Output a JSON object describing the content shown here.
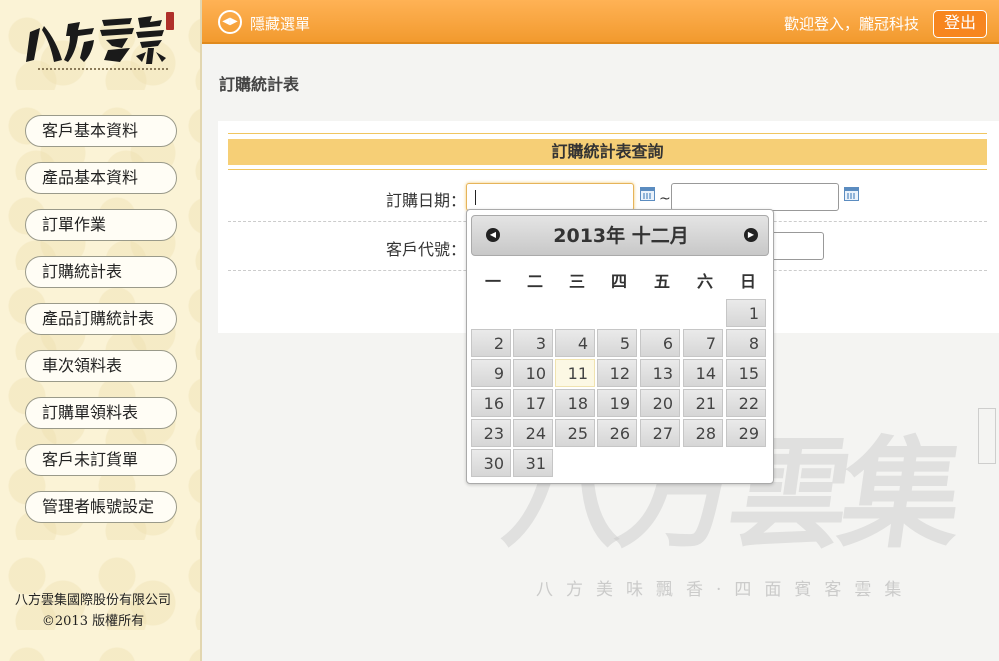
{
  "sidebar": {
    "logo_text": "八方雲集",
    "menu": [
      {
        "label": "客戶基本資料",
        "name": "menu-customer-info"
      },
      {
        "label": "產品基本資料",
        "name": "menu-product-info"
      },
      {
        "label": "訂單作業",
        "name": "menu-order-ops"
      },
      {
        "label": "訂購統計表",
        "name": "menu-order-stats"
      },
      {
        "label": "產品訂購統計表",
        "name": "menu-product-order-stats"
      },
      {
        "label": "車次領料表",
        "name": "menu-trip-material"
      },
      {
        "label": "訂購單領料表",
        "name": "menu-order-material"
      },
      {
        "label": "客戶未訂貨單",
        "name": "menu-customer-no-order"
      },
      {
        "label": "管理者帳號設定",
        "name": "menu-admin-account"
      }
    ],
    "footer_line1": "八方雲集國際股份有限公司",
    "footer_line2": "©2013 版權所有"
  },
  "topbar": {
    "toggle_label": "隱藏選單",
    "welcome": "歡迎登入，朧冠科技",
    "logout": "登出"
  },
  "page": {
    "title": "訂購統計表",
    "panel_title": "訂購統計表查詢",
    "order_date_label": "訂購日期：",
    "tilde": "~",
    "customer_code_label": "客戶代號："
  },
  "watermark": {
    "big": "八方雲集",
    "small": "八方美味飄香·四面賓客雲集"
  },
  "datepicker": {
    "title": "2013年 十二月",
    "weekdays": [
      "一",
      "二",
      "三",
      "四",
      "五",
      "六",
      "日"
    ],
    "first_weekday_index": 6,
    "days_in_month": 31,
    "today": 11
  },
  "colors": {
    "topbar": "#f29a2e",
    "panel_header": "#f6cf76",
    "sidebar_bg": "#fbf3d6"
  }
}
